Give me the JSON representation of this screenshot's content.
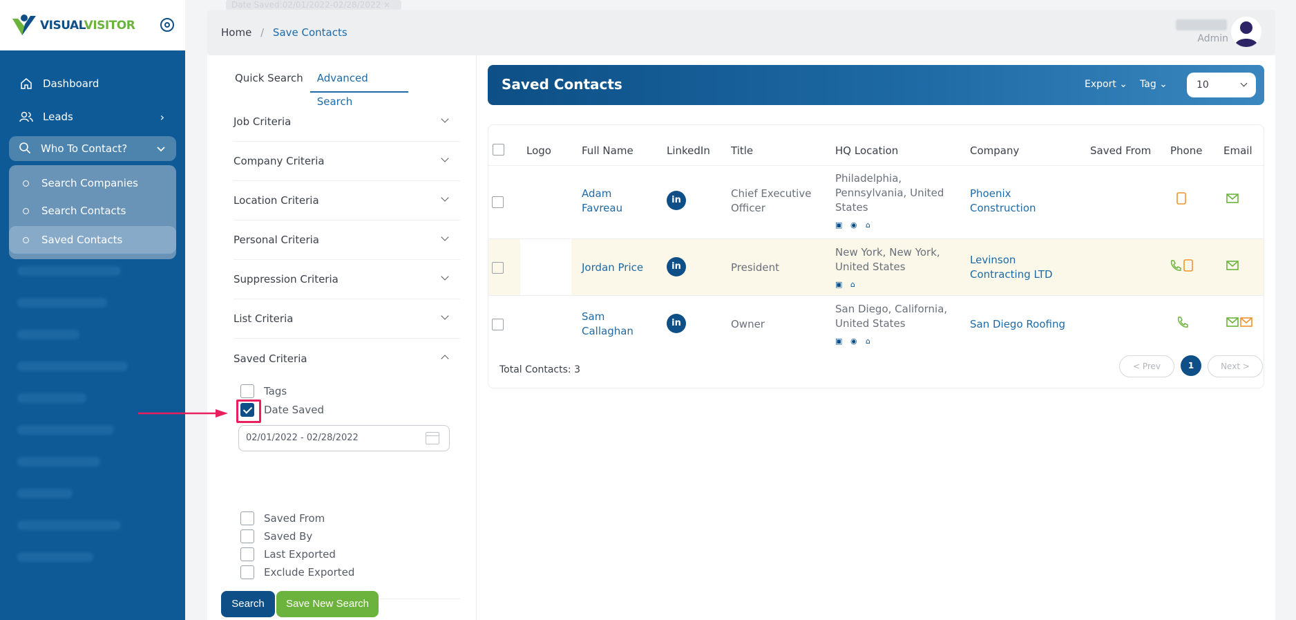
{
  "brand": {
    "logo_part1": "VISUAL",
    "logo_part2": "VISITOR"
  },
  "sidebar": {
    "items": [
      {
        "label": "Dashboard",
        "icon": "home-icon"
      },
      {
        "label": "Leads",
        "icon": "users-icon"
      }
    ],
    "open_section": {
      "label": "Who To Contact?",
      "icon": "search-icon"
    },
    "sub_items": [
      {
        "label": "Search Companies"
      },
      {
        "label": "Search Contacts"
      },
      {
        "label": "Saved Contacts",
        "active": true
      }
    ]
  },
  "header": {
    "ghost_chip": "Date Saved:02/01/2022-02/28/2022 ×",
    "breadcrumb_home": "Home",
    "breadcrumb_sep": "/",
    "breadcrumb_current": "Save Contacts",
    "user_role": "Admin"
  },
  "search_panel": {
    "tabs": [
      "Quick Search",
      "Advanced Search"
    ],
    "active_tab": "Advanced Search",
    "criteria": [
      "Job Criteria",
      "Company Criteria",
      "Location Criteria",
      "Personal Criteria",
      "Suppression Criteria",
      "List Criteria",
      "Saved Criteria"
    ],
    "saved_options": [
      {
        "label": "Tags",
        "checked": false
      },
      {
        "label": "Date Saved",
        "checked": true
      },
      {
        "label": "Saved From",
        "checked": false
      },
      {
        "label": "Saved By",
        "checked": false
      },
      {
        "label": "Last Exported",
        "checked": false
      },
      {
        "label": "Exclude Exported",
        "checked": false
      }
    ],
    "date_range_value": "02/01/2022 - 02/28/2022",
    "search_button": "Search",
    "save_button": "Save New Search"
  },
  "results": {
    "title": "Saved Contacts",
    "export_label": "Export",
    "tag_label": "Tag",
    "page_size": "10",
    "columns": [
      "Logo",
      "Full Name",
      "LinkedIn",
      "Title",
      "HQ Location",
      "Company",
      "Saved From",
      "Phone",
      "Email"
    ],
    "rows": [
      {
        "name_line1": "Adam",
        "name_line2": "Favreau",
        "linkedin": "in",
        "title_line1": "Chief Executive",
        "title_line2": "Officer",
        "loc_line1": "Philadelphia,",
        "loc_line2": "Pennsylvania, United",
        "loc_line3": "States",
        "company_line1": "Phoenix",
        "company_line2": "Construction"
      },
      {
        "name_line1": "Jordan Price",
        "linkedin": "in",
        "title_line1": "President",
        "loc_line1": "New York, New York,",
        "loc_line2": "United States",
        "company_line1": "Levinson",
        "company_line2": "Contracting LTD"
      },
      {
        "name_line1": "Sam",
        "name_line2": "Callaghan",
        "linkedin": "in",
        "title_line1": "Owner",
        "loc_line1": "San Diego, California,",
        "loc_line2": "United States",
        "company_line1": "San Diego Roofing"
      }
    ],
    "total_label": "Total Contacts: 3",
    "prev_label": "< Prev",
    "current_page": "1",
    "next_label": "Next >"
  },
  "colors": {
    "sidebar_bg": "#0d5a96",
    "primary": "#0d4f86",
    "accent_green": "#6cb33e",
    "link": "#1d6aa7",
    "highlight_red": "#e8215e",
    "phone_orange": "#f0932b"
  }
}
